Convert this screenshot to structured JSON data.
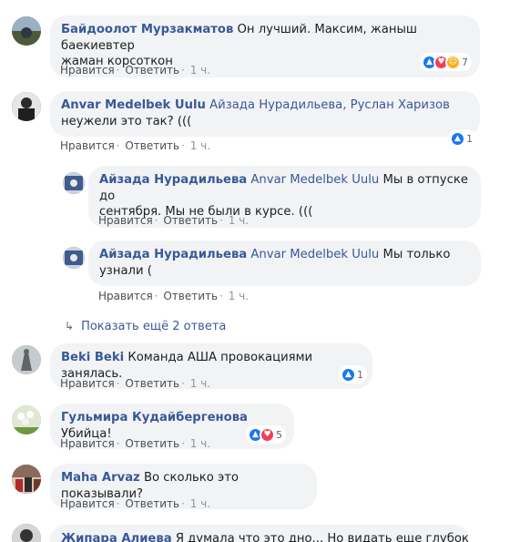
{
  "actions": {
    "like": "Нравится",
    "reply": "Ответить",
    "time": "1 ч."
  },
  "comments": [
    {
      "author": "Байдоолот Мурзакматов",
      "text_line1": "Он лучший. Максим, жаныш баекиевтер",
      "text_line2": "жаман корсоткон",
      "reaction_count": "7",
      "avatar_color": "#6c7a89"
    },
    {
      "author": "Anvar Medelbek Uulu",
      "mention": "Айзада Нурадильева, Руслан Харизов",
      "text_line2": "неужели это так? (((",
      "reaction_count": "1",
      "avatar_color": "#3b3b3b"
    },
    {
      "author": "Айзада Нурадильева",
      "mention": "Anvar Medelbek Uulu",
      "text_line1_rest": "Мы в отпуске до",
      "text_line2": "сентября. Мы не были в курсе. (((",
      "avatar_color": "#4a5d8a"
    },
    {
      "author": "Айзада Нурадильева",
      "mention": "Anvar Medelbek Uulu",
      "text_line1_rest": "Мы только",
      "text_line2": "узнали (",
      "avatar_color": "#4a5d8a"
    },
    {
      "author": "Beki Beki",
      "text": "Команда АША провокациями занялась.",
      "reaction_count": "1",
      "avatar_color": "#8e9497"
    },
    {
      "author": "Гульмира Кудайбергенова",
      "text": "Убийца!",
      "reaction_count": "5",
      "avatar_color": "#7da35a"
    },
    {
      "author": "Maha Arvaz",
      "text": "Во сколько это показывали?",
      "avatar_color": "#6b3a2e"
    },
    {
      "author": "Жипара Алиева",
      "text": "Я думала что это дно... Но видать еще глубоко",
      "avatar_color": "#555555"
    }
  ],
  "more_replies": "Показать ещё 2 ответа",
  "icons": {
    "like": "thumbs-up-icon",
    "love": "heart-icon",
    "haha": "haha-icon",
    "arrow": "reply-arrow-icon"
  }
}
